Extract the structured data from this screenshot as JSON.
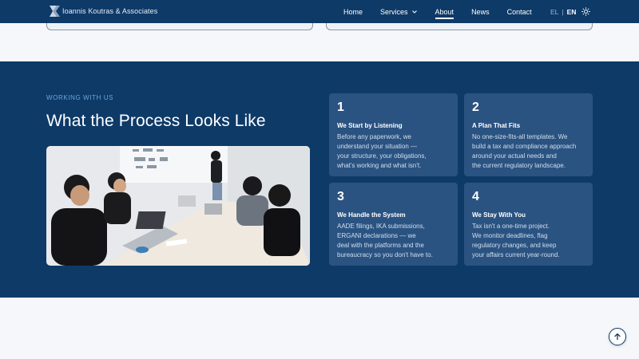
{
  "brand": {
    "name": "Ioannis Koutras & Associates",
    "logo_icon": "logo-mark"
  },
  "nav": {
    "items": [
      {
        "label": "Home",
        "active": false
      },
      {
        "label": "Services",
        "active": false,
        "has_dropdown": true
      },
      {
        "label": "About",
        "active": true
      },
      {
        "label": "News",
        "active": false
      },
      {
        "label": "Contact",
        "active": false
      }
    ],
    "lang": {
      "el": "EL",
      "sep": "|",
      "en": "EN",
      "selected": "EN"
    },
    "theme_icon": "sun-icon"
  },
  "process": {
    "eyebrow": "WORKING WITH US",
    "heading": "What the Process Looks Like",
    "photo_icon": "team-meeting-photo",
    "steps": [
      {
        "num": "1",
        "title": "We Start by Listening",
        "lines": [
          "Before any paperwork, we",
          "understand your situation —",
          "your structure, your obligations,",
          "what's working and what isn't."
        ]
      },
      {
        "num": "2",
        "title": "A Plan That Fits",
        "lines": [
          "No one-size-fits-all templates. We",
          "build a tax and compliance approach",
          "around your actual needs and",
          "the current regulatory landscape."
        ]
      },
      {
        "num": "3",
        "title": "We Handle the System",
        "lines": [
          "AADE filings, IKA submissions,",
          "ERGANI declarations — we",
          "deal with the platforms and the",
          "bureaucracy so you don't have to."
        ]
      },
      {
        "num": "4",
        "title": "We Stay With You",
        "lines": [
          "Tax isn't a one-time project.",
          "We monitor deadlines, flag",
          "regulatory changes, and keep",
          "your affairs current year-round."
        ]
      }
    ]
  },
  "colors": {
    "navy": "#0e3a68",
    "card": "#2a5382",
    "accent": "#6aa7d8",
    "page_bg": "#f5f7fb"
  },
  "scroll_top_icon": "arrow-up-icon"
}
